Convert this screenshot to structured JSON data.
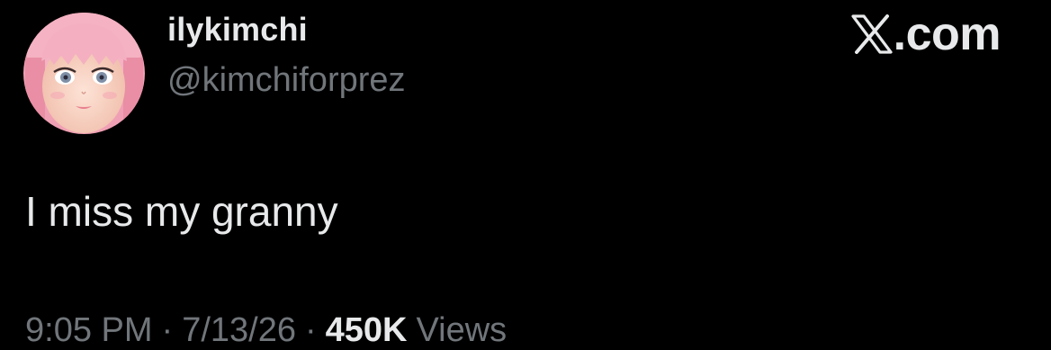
{
  "user": {
    "display_name": "ilykimchi",
    "handle": "@kimchiforprez",
    "avatar_icon": "doll-face-avatar"
  },
  "watermark": {
    "icon": "x-logo-icon",
    "text": ".com"
  },
  "tweet": {
    "text": "I miss my granny"
  },
  "meta": {
    "time": "9:05 PM",
    "separator": "·",
    "date": "7/13/26",
    "views_count": "450K",
    "views_label": "Views"
  },
  "colors": {
    "background": "#000000",
    "primary_text": "#e7e9ea",
    "secondary_text": "#71767b",
    "avatar_hair": "#f2a3b6"
  }
}
